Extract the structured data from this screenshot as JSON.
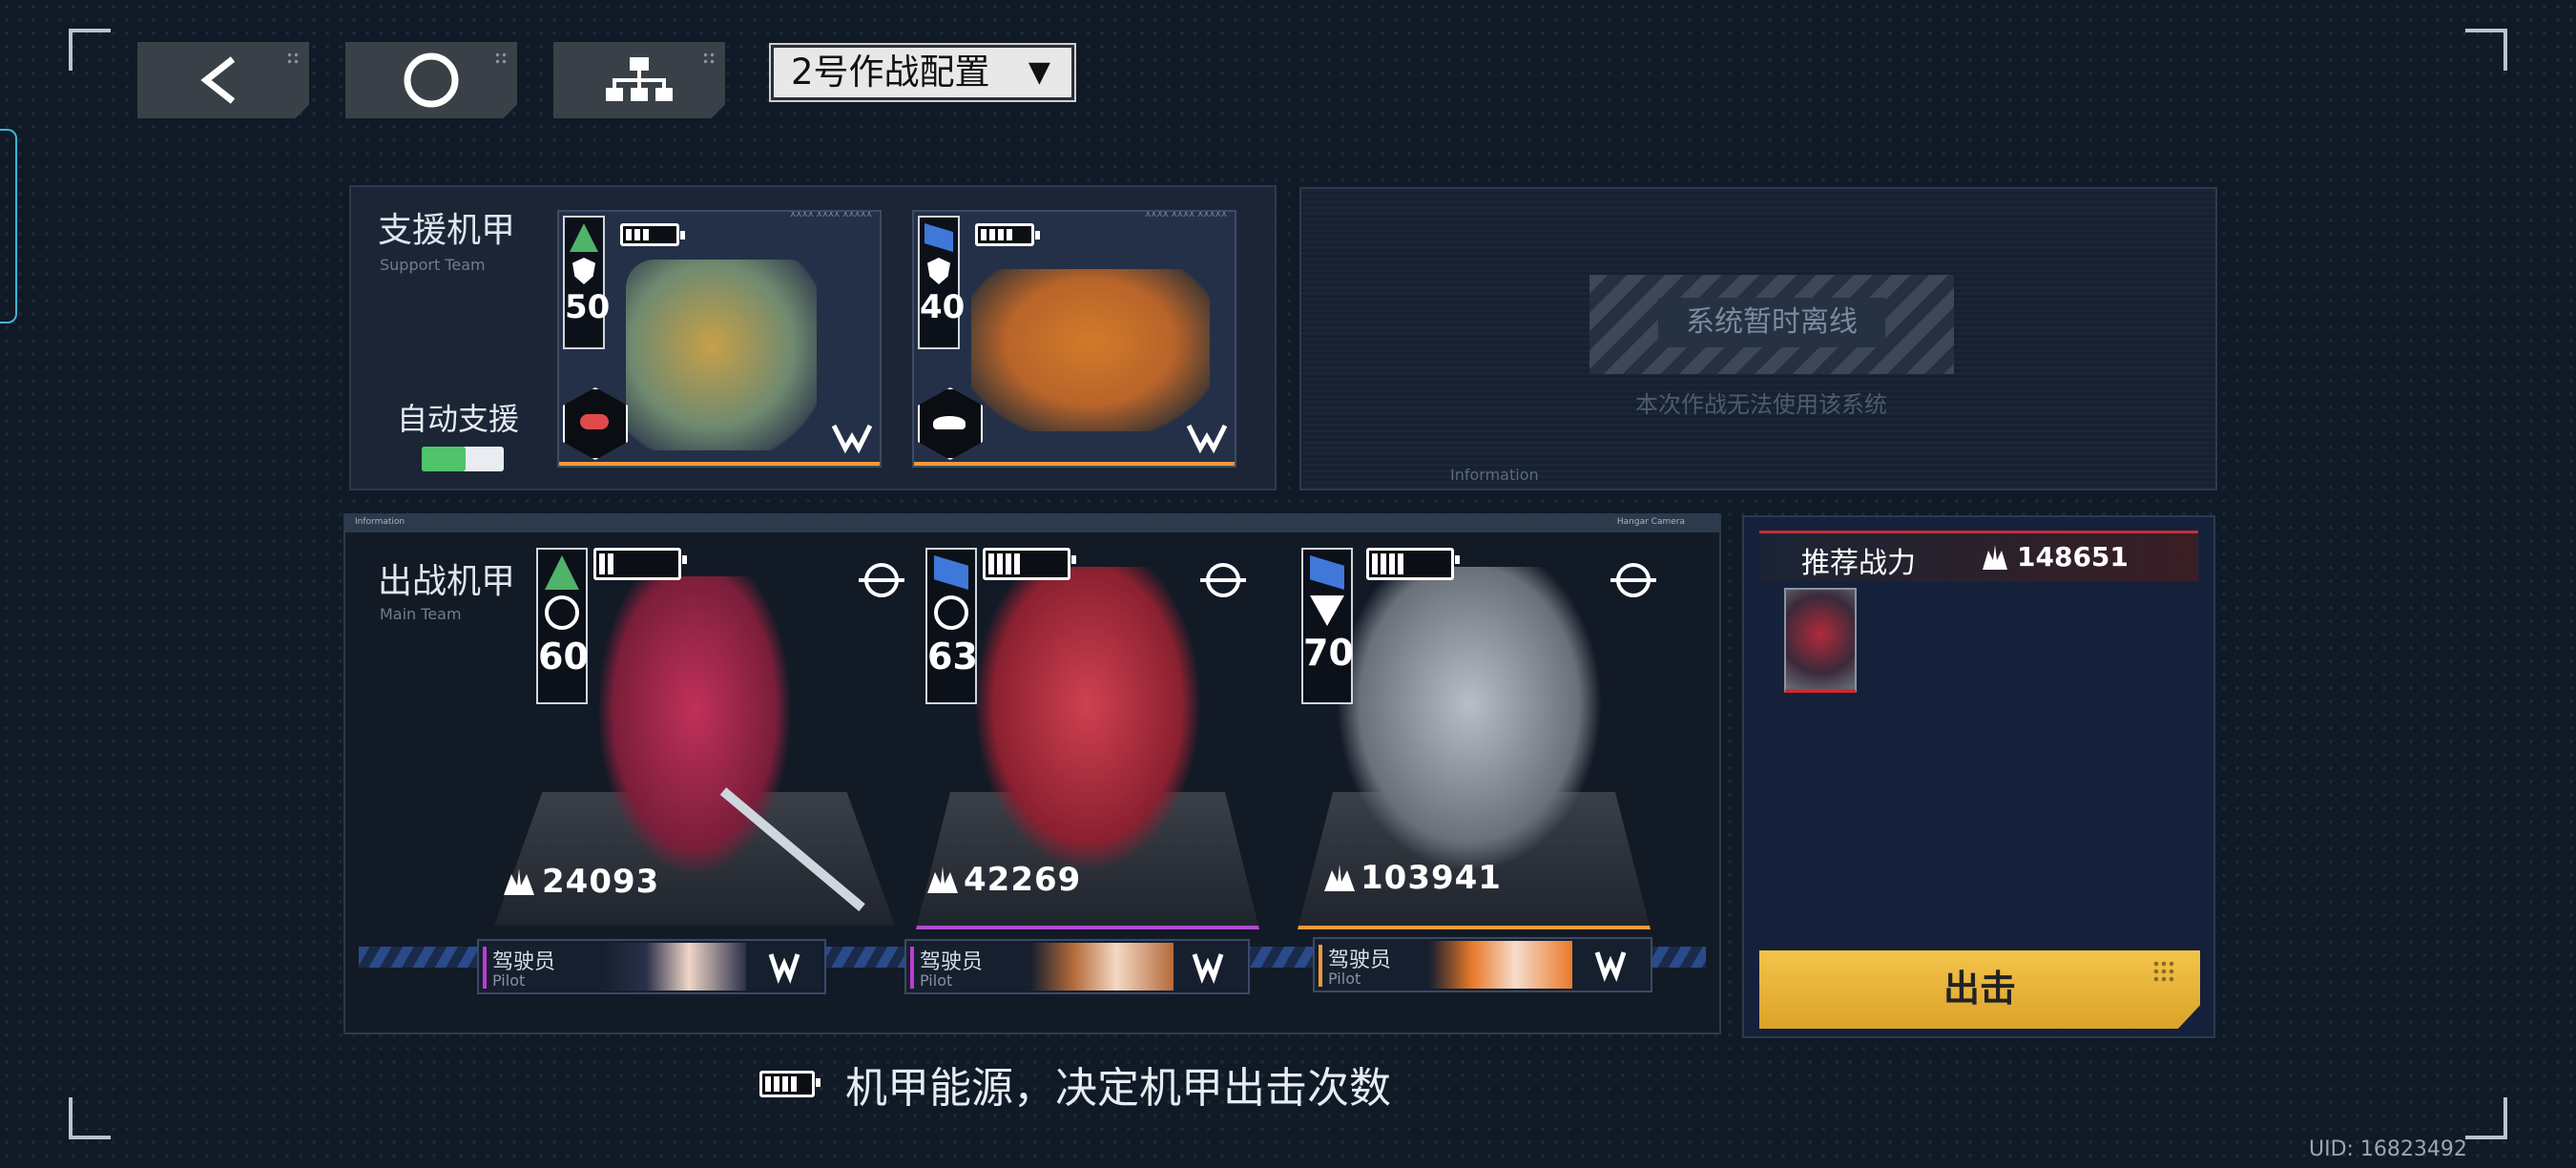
{
  "header": {
    "back_icon": "chevron-left-icon",
    "home_icon": "circle-icon",
    "tree_icon": "hierarchy-icon",
    "config_select": "2号作战配置",
    "config_arrow": "▼"
  },
  "support": {
    "title": "支援机甲",
    "subtitle": "Support Team",
    "auto_label": "自动支援",
    "auto_enabled": true,
    "cards": [
      {
        "level": "50",
        "battery": 3,
        "top_text": "XXXX XXXX XXXXX",
        "rank_color": "#4fb36a"
      },
      {
        "level": "40",
        "battery": 4,
        "top_text": "XXXX XXXX XXXXX",
        "rank_color": "#3f78d8"
      }
    ]
  },
  "system": {
    "offline": "系统暂时离线",
    "desc": "本次作战无法使用该系统",
    "info": "Information"
  },
  "main": {
    "title": "出战机甲",
    "subtitle": "Main Team",
    "info_left": "Information",
    "info_right": "Hangar Camera",
    "mechs": [
      {
        "level": "60",
        "cp": "24093",
        "battery": 2,
        "pilot_cn": "驾驶员",
        "pilot_en": "Pilot",
        "rank_color": "#4fb36a",
        "body": "#a8304f"
      },
      {
        "level": "63",
        "cp": "42269",
        "battery": 4,
        "pilot_cn": "驾驶员",
        "pilot_en": "Pilot",
        "rank_color": "#3f78d8",
        "body": "#b83848"
      },
      {
        "level": "70",
        "cp": "103941",
        "battery": 4,
        "pilot_cn": "驾驶员",
        "pilot_en": "Pilot",
        "rank_color": "#3f78d8",
        "body": "#8a9099"
      }
    ]
  },
  "recommend": {
    "label": "推荐战力",
    "cp": "148651",
    "sortie": "出击"
  },
  "hint": "机甲能源，决定机甲出击次数",
  "uid": "UID: 16823492",
  "colors": {
    "accent_orange": "#f39a3a",
    "sortie_yellow": "#f3c44a",
    "toggle_green": "#4fc46a"
  }
}
